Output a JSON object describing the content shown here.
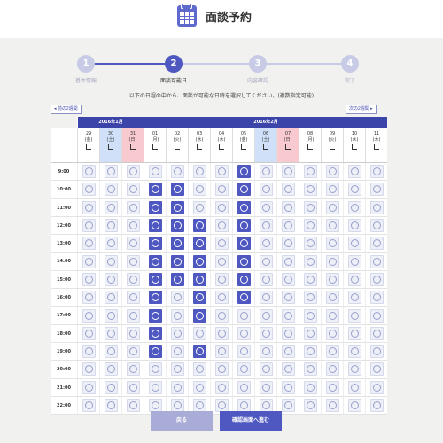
{
  "header": {
    "title": "面談予約",
    "icon": "calendar-icon"
  },
  "steps": [
    {
      "number": "1",
      "label": "基本情報",
      "active": false
    },
    {
      "number": "2",
      "label": "面談可能日",
      "active": true
    },
    {
      "number": "3",
      "label": "内容確認",
      "active": false
    },
    {
      "number": "4",
      "label": "完了",
      "active": false
    }
  ],
  "instruction": "以下の日程の中から、面談が可能な日時を選択してください。(複数指定可能)",
  "nav": {
    "prev": "◂ 前の2週間",
    "next": "次の2週間 ▸"
  },
  "months": [
    {
      "label": "2016年1月",
      "span": 3
    },
    {
      "label": "2016年2月",
      "span": 11
    }
  ],
  "dates": [
    {
      "day": "29",
      "dow": "(金)",
      "type": "weekday"
    },
    {
      "day": "30",
      "dow": "(土)",
      "type": "sat"
    },
    {
      "day": "31",
      "dow": "(日)",
      "type": "sun"
    },
    {
      "day": "01",
      "dow": "(月)",
      "type": "weekday",
      "checked": true
    },
    {
      "day": "02",
      "dow": "(火)",
      "type": "weekday",
      "checked": true
    },
    {
      "day": "03",
      "dow": "(水)",
      "type": "weekday",
      "checked": true
    },
    {
      "day": "04",
      "dow": "(木)",
      "type": "weekday"
    },
    {
      "day": "05",
      "dow": "(金)",
      "type": "weekday"
    },
    {
      "day": "06",
      "dow": "(土)",
      "type": "sat"
    },
    {
      "day": "07",
      "dow": "(日)",
      "type": "sun"
    },
    {
      "day": "08",
      "dow": "(月)",
      "type": "weekday"
    },
    {
      "day": "09",
      "dow": "(火)",
      "type": "weekday"
    },
    {
      "day": "10",
      "dow": "(水)",
      "type": "weekday"
    },
    {
      "day": "11",
      "dow": "(木)",
      "type": "weekday"
    }
  ],
  "times": [
    "9:00",
    "10:00",
    "11:00",
    "12:00",
    "13:00",
    "14:00",
    "15:00",
    "16:00",
    "17:00",
    "18:00",
    "19:00",
    "20:00",
    "21:00",
    "22:00"
  ],
  "selected": [
    [
      7
    ],
    [
      3,
      4,
      7
    ],
    [
      3,
      4,
      7
    ],
    [
      3,
      4,
      5,
      7
    ],
    [
      3,
      4,
      5,
      7
    ],
    [
      3,
      4,
      5,
      7
    ],
    [
      3,
      4,
      5,
      7
    ],
    [
      3,
      5,
      7
    ],
    [
      3,
      5
    ],
    [
      3
    ],
    [
      3,
      5
    ],
    [],
    [],
    []
  ],
  "colors": {
    "primary": "#4f58c0",
    "navy": "#3b44a8",
    "sat": "#cfe0f8",
    "sun": "#f8c9cf"
  },
  "buttons": {
    "back": "戻る",
    "next": "確認画面へ進む"
  }
}
